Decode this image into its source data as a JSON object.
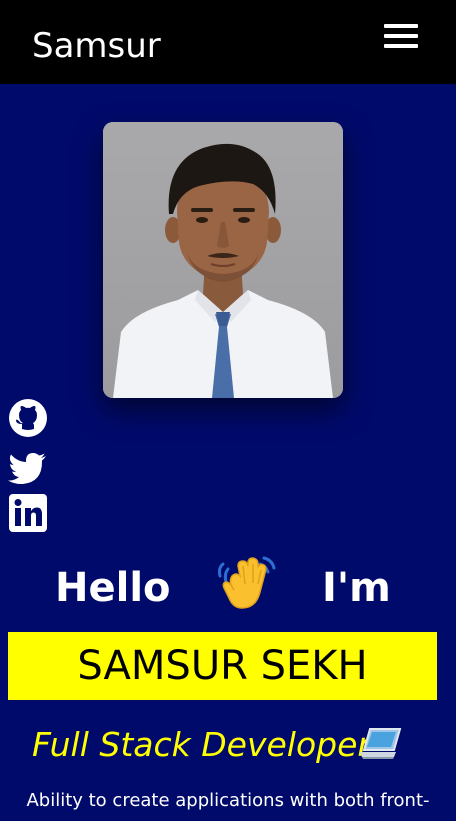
{
  "navbar": {
    "brand": "Samsur",
    "menu_icon": "hamburger-menu-icon"
  },
  "profile": {
    "photo": "profile-photo",
    "greeting_hello": "Hello",
    "greeting_icon": "waving-hand-icon",
    "greeting_im": "I'm",
    "name": "SAMSUR SEKH",
    "role": "Full Stack Developer",
    "role_icon": "laptop-icon",
    "description": "Ability to create applications with both front-"
  },
  "socials": [
    {
      "icon": "github-icon"
    },
    {
      "icon": "twitter-icon"
    },
    {
      "icon": "linkedin-icon"
    }
  ],
  "colors": {
    "background": "#000a6b",
    "navbar": "#000000",
    "accent": "#ffff00",
    "text": "#ffffff"
  }
}
